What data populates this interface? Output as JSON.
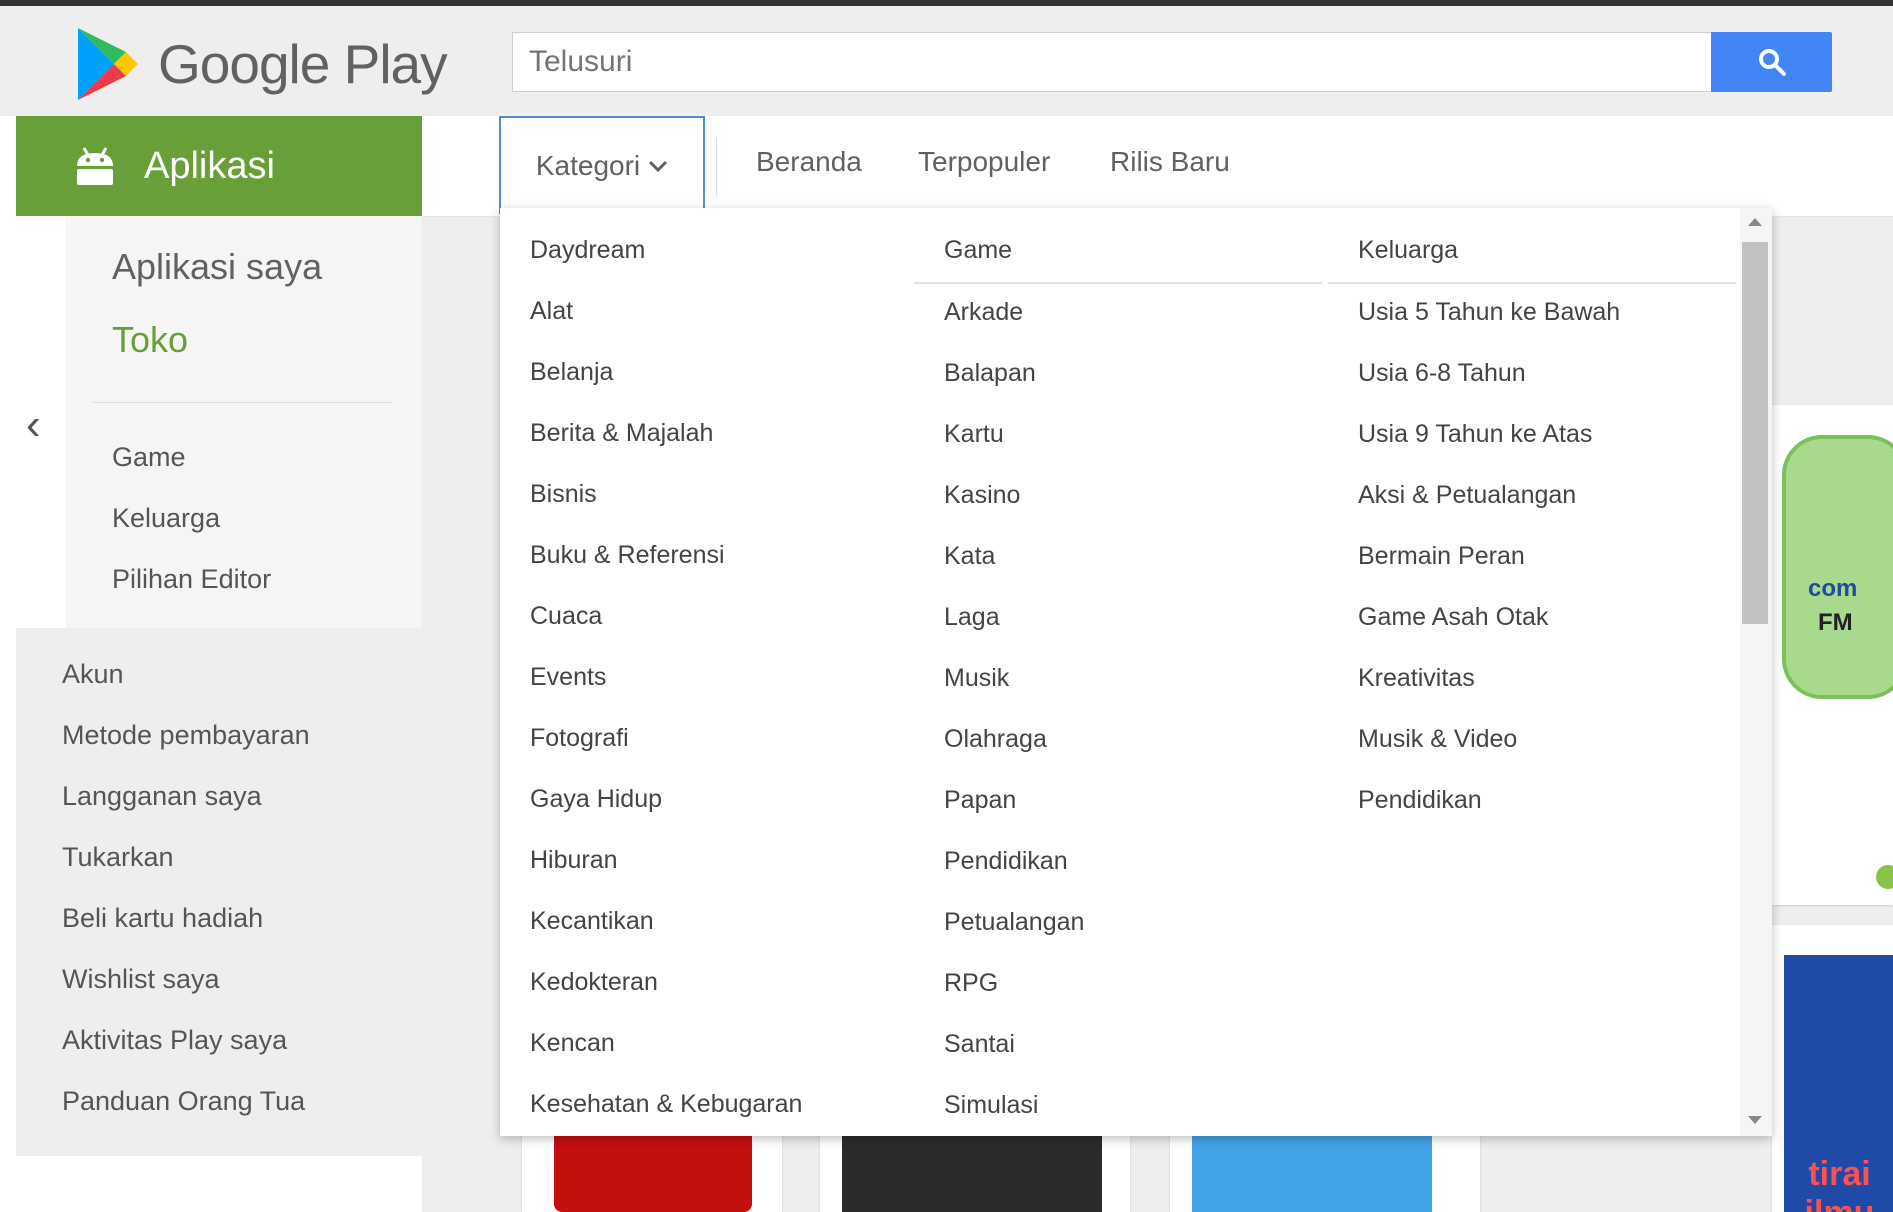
{
  "header": {
    "brand": "Google Play",
    "search_placeholder": "Telusuri"
  },
  "left_nav": {
    "section_label": "Aplikasi",
    "my_apps": "Aplikasi saya",
    "store": "Toko",
    "sub_items": [
      "Game",
      "Keluarga",
      "Pilihan Editor"
    ],
    "account_items": [
      "Akun",
      "Metode pembayaran",
      "Langganan saya",
      "Tukarkan",
      "Beli kartu hadiah",
      "Wishlist saya",
      "Aktivitas Play saya",
      "Panduan Orang Tua"
    ]
  },
  "tabs": {
    "kategori": "Kategori",
    "items": [
      "Beranda",
      "Terpopuler",
      "Rilis Baru"
    ]
  },
  "dropdown": {
    "col1": [
      "Daydream",
      "Alat",
      "Belanja",
      "Berita & Majalah",
      "Bisnis",
      "Buku & Referensi",
      "Cuaca",
      "Events",
      "Fotografi",
      "Gaya Hidup",
      "Hiburan",
      "Kecantikan",
      "Kedokteran",
      "Kencan",
      "Kesehatan & Kebugaran"
    ],
    "col2_header": "Game",
    "col2": [
      "Arkade",
      "Balapan",
      "Kartu",
      "Kasino",
      "Kata",
      "Laga",
      "Musik",
      "Olahraga",
      "Papan",
      "Pendidikan",
      "Petualangan",
      "RPG",
      "Santai",
      "Simulasi"
    ],
    "col3_header": "Keluarga",
    "col3": [
      "Usia 5 Tahun ke Bawah",
      "Usia 6-8 Tahun",
      "Usia 9 Tahun ke Atas",
      "Aksi & Petualangan",
      "Bermain Peran",
      "Game Asah Otak",
      "Kreativitas",
      "Musik & Video",
      "Pendidikan"
    ]
  },
  "background_cards": {
    "card1_text_line1": "com",
    "card1_text_line2": "FM",
    "card2_text": "tirai ilmu"
  },
  "colors": {
    "apps_green": "#689f38",
    "search_blue": "#4285f4",
    "focus_border": "#4a90d9"
  }
}
